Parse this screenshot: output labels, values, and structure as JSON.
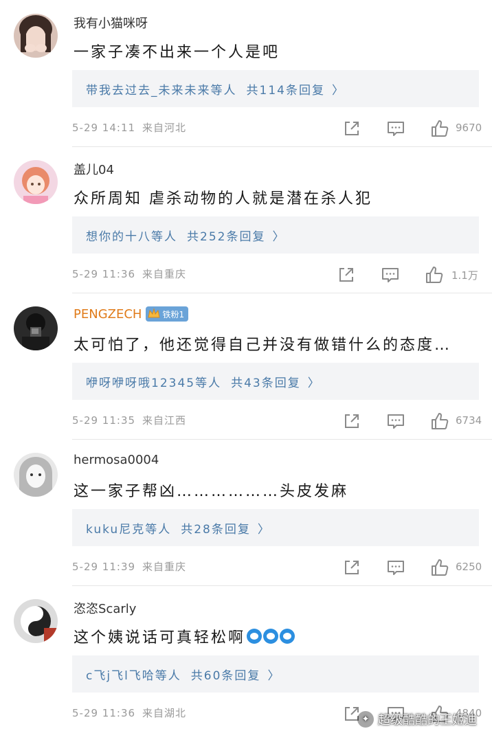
{
  "comments": [
    {
      "username": "我有小猫咪呀",
      "text": "一家子凑不出来一个人是吧",
      "reply_users": "带我去过去_未来未来等人",
      "reply_total": "共114条回复",
      "time": "5-29 14:11",
      "source": "来自河北",
      "likes": "9670"
    },
    {
      "username": "盖儿04",
      "text": "众所周知 虐杀动物的人就是潜在杀人犯",
      "reply_users": "想你的十八等人",
      "reply_total": "共252条回复",
      "time": "5-29 11:36",
      "source": "来自重庆",
      "likes": "1.1万"
    },
    {
      "username": "PENGZECH",
      "badge": "铁粉1",
      "text": "太可怕了，他还觉得自己并没有做错什么的态度…",
      "reply_users": "咿呀咿呀哦12345等人",
      "reply_total": "共43条回复",
      "time": "5-29 11:35",
      "source": "来自江西",
      "likes": "6734"
    },
    {
      "username": "hermosa0004",
      "text": "这一家子帮凶………………头皮发麻",
      "reply_users": "kuku尼克等人",
      "reply_total": "共28条回复",
      "time": "5-29 11:39",
      "source": "来自重庆",
      "likes": "6250"
    },
    {
      "username": "恣恣Scarly",
      "text": "这个姨说话可真轻松啊",
      "reply_users": "c飞j飞l飞哈等人",
      "reply_total": "共60条回复",
      "time": "5-29 11:36",
      "source": "来自湖北",
      "likes": "4840"
    }
  ],
  "chevron": "〉",
  "watermark": "超级酷酷的王姬迪",
  "colors": {
    "reply_link": "#4a7aa8",
    "meta_gray": "#9a9a9a",
    "username_vip": "#e07b1a",
    "fan_badge": "#6aa3d8"
  }
}
